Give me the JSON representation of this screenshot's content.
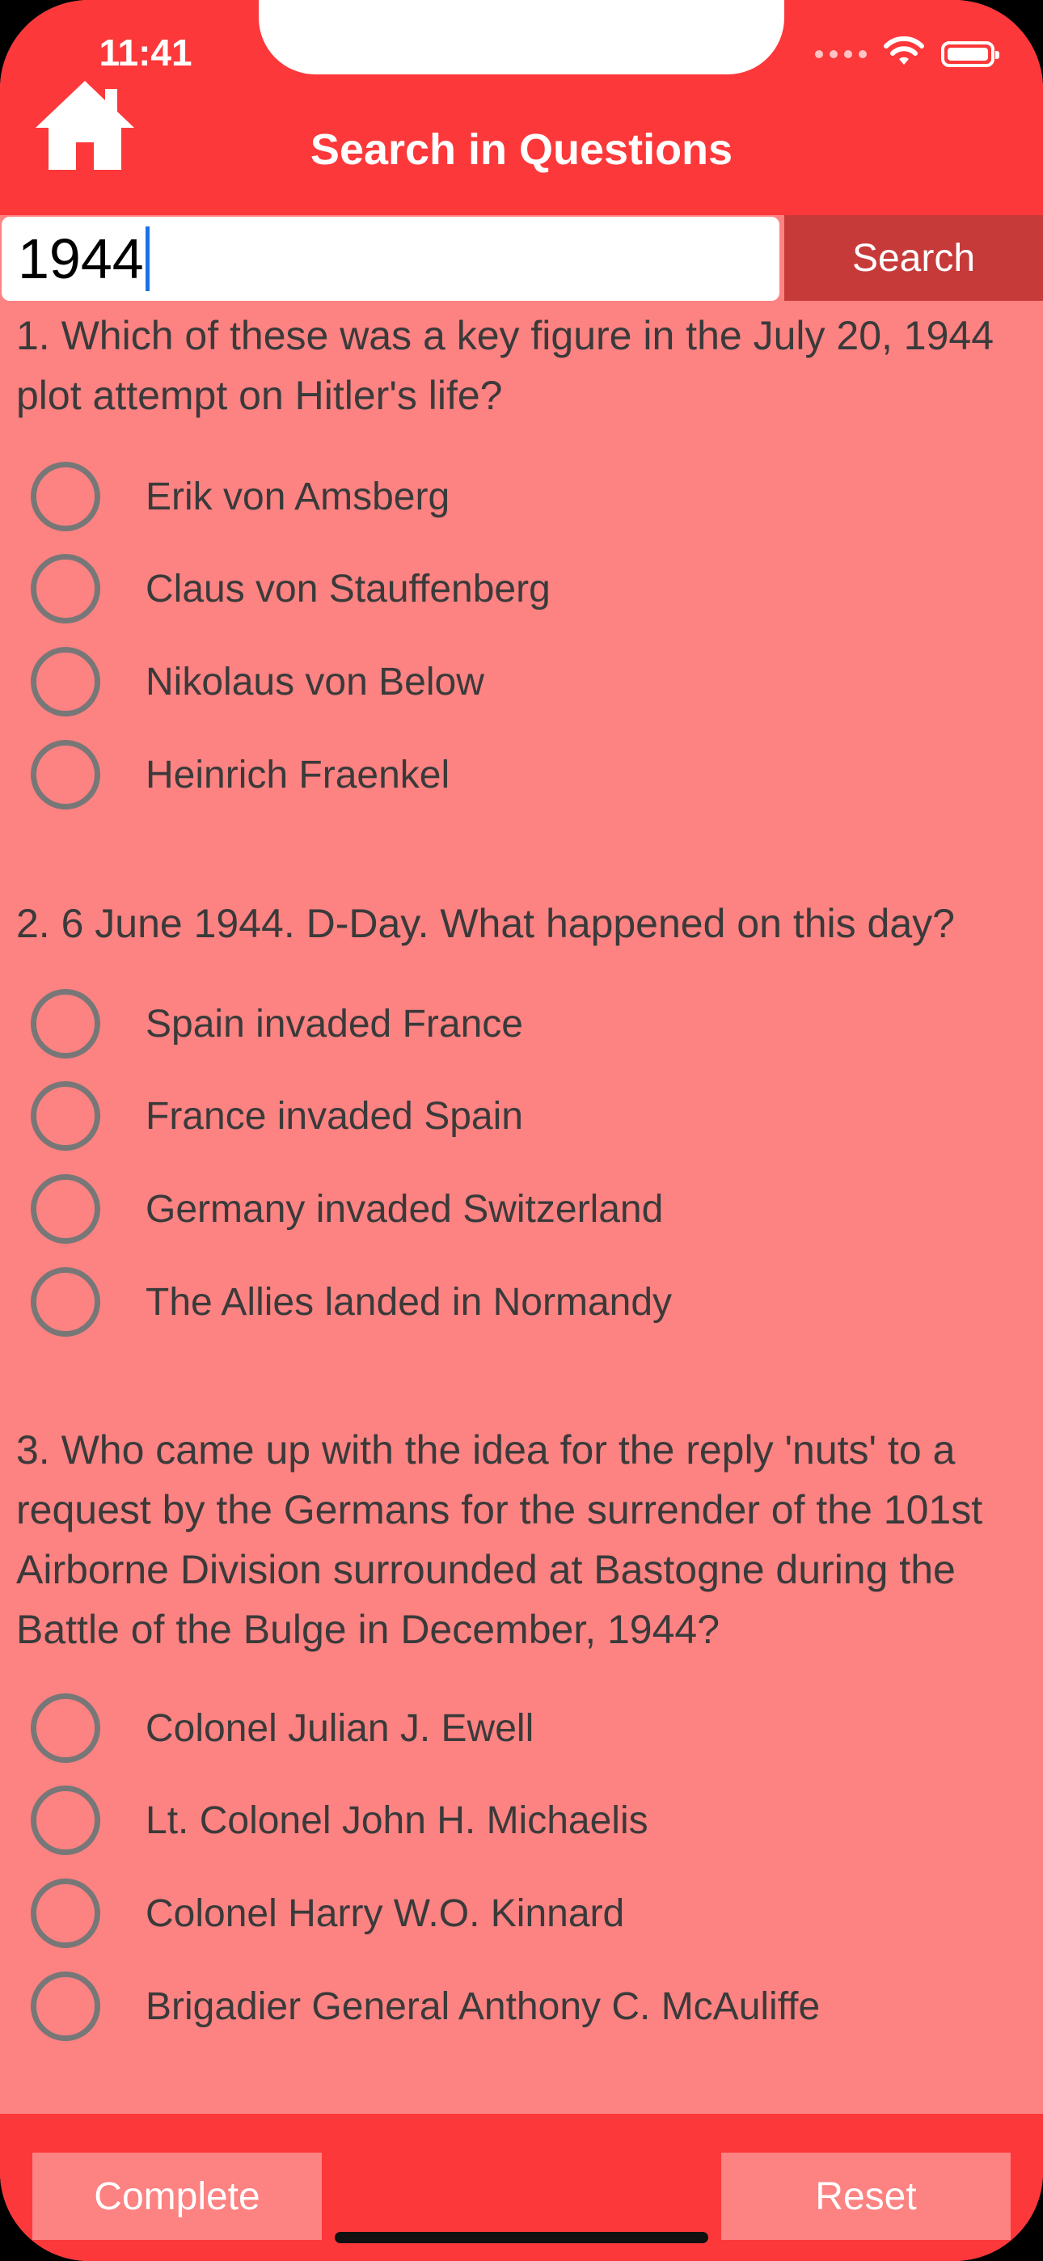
{
  "status": {
    "time": "11:41"
  },
  "header": {
    "title": "Search in Questions",
    "home_icon": "house-icon"
  },
  "search": {
    "value": "1944",
    "button_label": "Search"
  },
  "questions": [
    {
      "text": "1. Which of these was a key figure in the July 20, 1944 plot attempt on Hitler's life?",
      "options": [
        "Erik von Amsberg",
        "Claus von Stauffenberg",
        "Nikolaus von Below",
        "Heinrich Fraenkel"
      ]
    },
    {
      "text": "2. 6 June 1944. D-Day. What happened on this day?",
      "options": [
        "Spain invaded France",
        "France invaded Spain",
        "Germany invaded Switzerland",
        "The Allies landed in Normandy"
      ]
    },
    {
      "text": "3. Who came up with the idea for the reply 'nuts' to a request by the Germans for the surrender of the 101st Airborne Division surrounded at Bastogne during the Battle of the Bulge in December, 1944?",
      "options": [
        "Colonel Julian J. Ewell",
        "Lt. Colonel John H. Michaelis",
        "Colonel Harry W.O. Kinnard",
        "Brigadier General Anthony C. McAuliffe"
      ]
    }
  ],
  "footer": {
    "complete_label": "Complete",
    "reset_label": "Reset"
  },
  "colors": {
    "header": "#FC383A",
    "background": "#FD8282",
    "search_button": "#C73A3A"
  }
}
